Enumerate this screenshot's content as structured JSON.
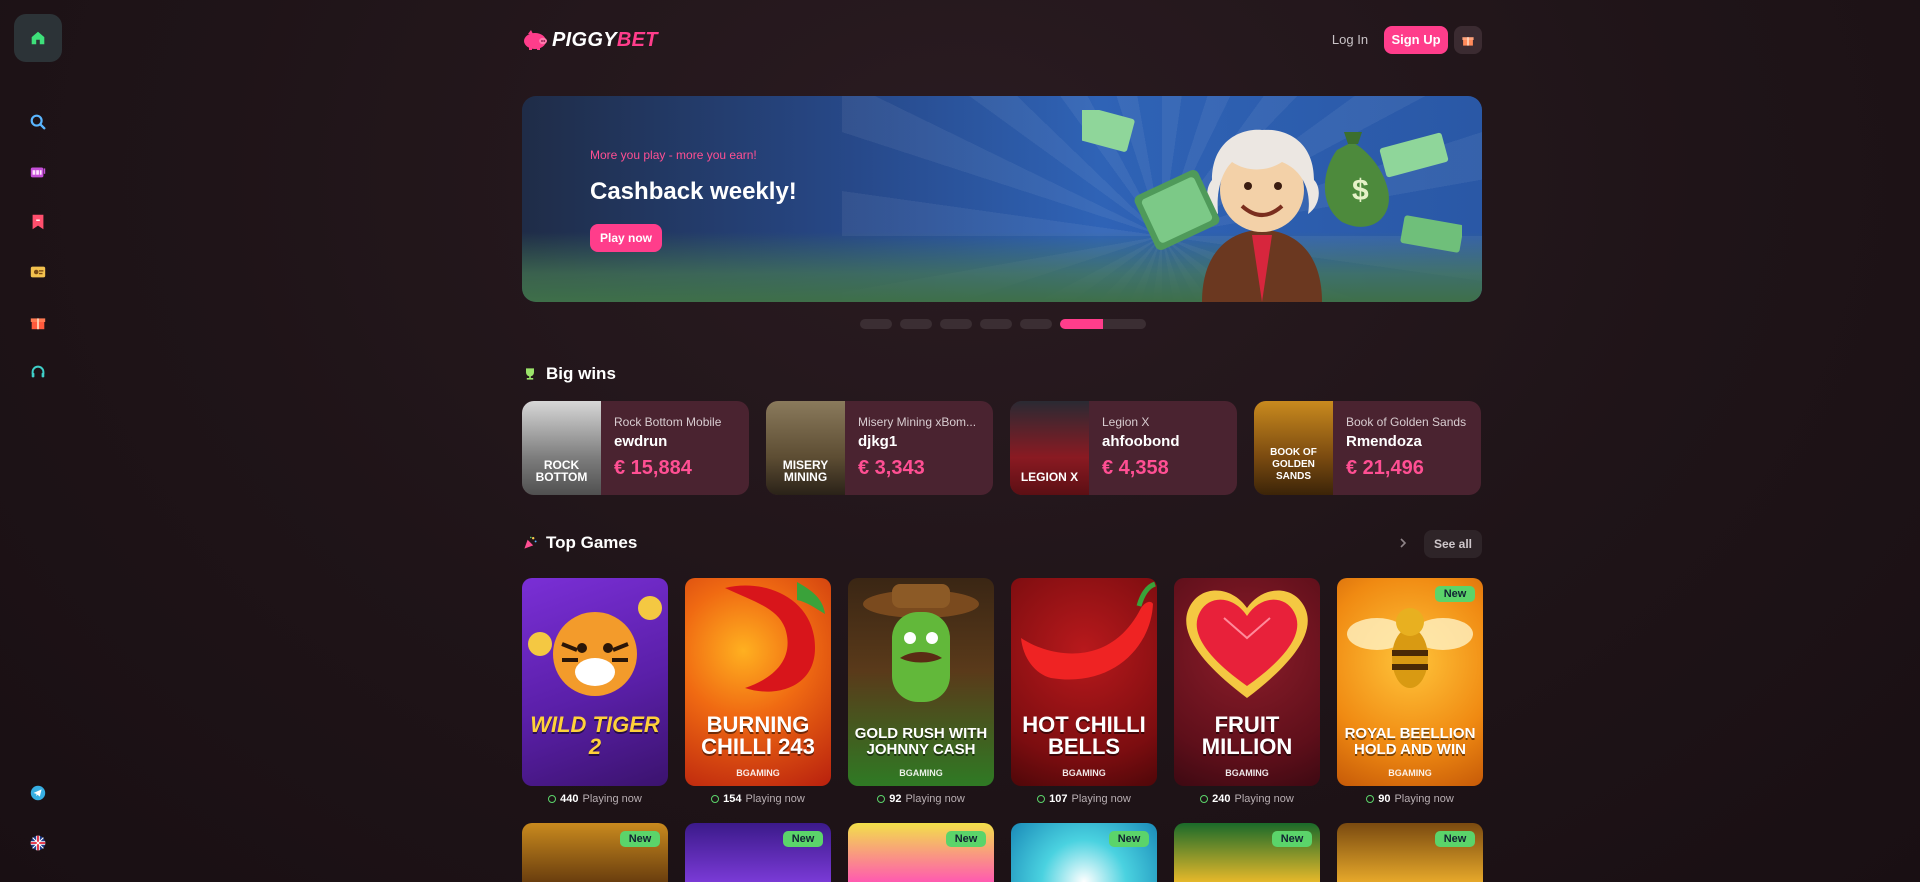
{
  "brand": {
    "piggy": "PIGGY",
    "bet": "BET"
  },
  "header": {
    "login": "Log In",
    "signup": "Sign Up"
  },
  "sidebar": {
    "items": [
      "home-icon",
      "search-icon",
      "slots-icon",
      "bookmark-icon",
      "live-icon",
      "gift-icon",
      "support-icon",
      "telegram-icon",
      "language-icon"
    ]
  },
  "banner": {
    "subtitle": "More you play - more you earn!",
    "title": "Cashback weekly!",
    "cta": "Play now"
  },
  "big_wins": {
    "title": "Big wins",
    "items": [
      {
        "game": "Rock Bottom Mobile",
        "user": "ewdrun",
        "amount": "€ 15,884",
        "thumb": "ROCK BOTTOM"
      },
      {
        "game": "Misery Mining xBom...",
        "user": "djkg1",
        "amount": "€ 3,343",
        "thumb": "MISERY MINING"
      },
      {
        "game": "Legion X",
        "user": "ahfoobond",
        "amount": "€ 4,358",
        "thumb": "LEGION X"
      },
      {
        "game": "Book of Golden Sands",
        "user": "Rmendoza",
        "amount": "€ 21,496",
        "thumb": "BOOK OF GOLDEN SANDS"
      }
    ]
  },
  "top_games": {
    "title": "Top Games",
    "see_all": "See all",
    "playing_label": "Playing now",
    "items": [
      {
        "title": "WILD TIGER 2",
        "provider": "",
        "players": "440",
        "new": false
      },
      {
        "title": "BURNING CHILLI 243",
        "provider": "BGAMING",
        "players": "154",
        "new": false
      },
      {
        "title": "GOLD RUSH WITH JOHNNY CASH",
        "provider": "BGAMING",
        "players": "92",
        "new": false
      },
      {
        "title": "HOT CHILLI BELLS",
        "provider": "BGAMING",
        "players": "107",
        "new": false
      },
      {
        "title": "FRUIT MILLION",
        "provider": "BGAMING",
        "players": "240",
        "new": false
      },
      {
        "title": "ROYAL BEELLION HOLD AND WIN",
        "provider": "BGAMING",
        "players": "90",
        "new": true,
        "badge": "New"
      }
    ],
    "row2_badge": "New"
  },
  "colors": {
    "accent": "#ff3d8b",
    "new_badge": "#5bd46a",
    "card_bg": "#4a2330"
  }
}
